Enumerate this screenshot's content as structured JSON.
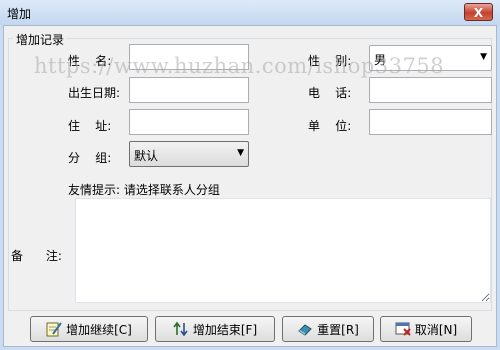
{
  "window": {
    "title": "增加",
    "close_glyph": "X"
  },
  "group": {
    "title": "增加记录"
  },
  "fields": {
    "name": {
      "label": "性    名:",
      "value": ""
    },
    "gender": {
      "label": "性    别:",
      "value": "男"
    },
    "birthday": {
      "label": "出生日期:",
      "value": ""
    },
    "phone": {
      "label": "电    话:",
      "value": ""
    },
    "address": {
      "label": "住    址:",
      "value": ""
    },
    "company": {
      "label": "单    位:",
      "value": ""
    },
    "group": {
      "label": "分    组:",
      "value": "默认"
    },
    "remark": {
      "label": "备      注:",
      "value": ""
    }
  },
  "hint": "友情提示: 请选择联系人分组",
  "watermark": "https://www.huzhan.com/ishop33758",
  "buttons": {
    "add_continue": "增加继续[C]",
    "add_finish": "增加结束[F]",
    "reset": "重置[R]",
    "cancel": "取消[N]"
  },
  "icons": {
    "add_continue": "edit-note-icon",
    "add_finish": "sort-arrows-icon",
    "reset": "eraser-icon",
    "cancel": "cancel-window-icon"
  },
  "colors": {
    "title_bar": "#c9dcf2",
    "close_button": "#c6402f",
    "form_bg": "#f0f0f0"
  }
}
